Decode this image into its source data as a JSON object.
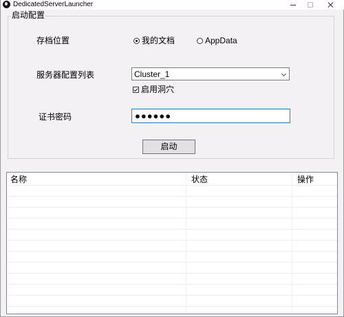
{
  "window": {
    "title": "DedicatedServerLauncher"
  },
  "launch_config": {
    "group_title": "启动配置",
    "save_location_label": "存档位置",
    "save_options": [
      {
        "label": "我的文档",
        "selected": true
      },
      {
        "label": "AppData",
        "selected": false
      }
    ],
    "server_config_label": "服务器配置列表",
    "server_config_value": "Cluster_1",
    "enable_caves_label": "启用洞穴",
    "enable_caves_checked": true,
    "token_label": "证书密码",
    "token_masked": "●●●●●●",
    "launch_button": "启动"
  },
  "server_list": {
    "columns": [
      "名称",
      "状态",
      "操作"
    ],
    "rows": []
  }
}
